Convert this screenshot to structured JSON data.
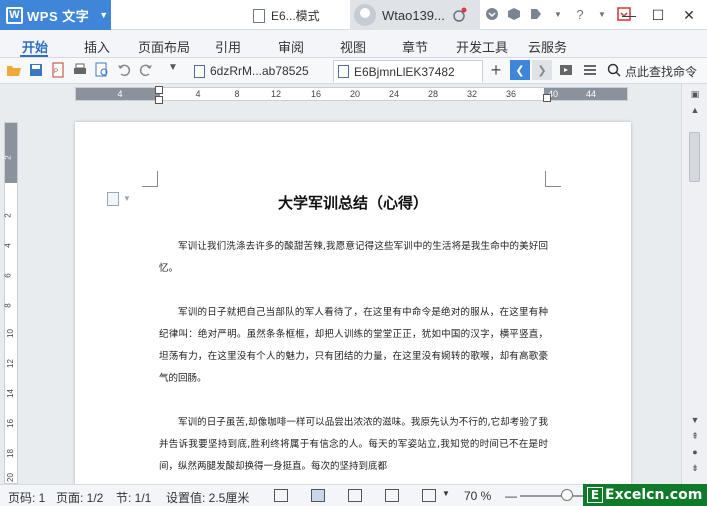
{
  "titlebar": {
    "app_name": "WPS 文字",
    "logo_letter": "W",
    "doc_title": "E6...模式",
    "user_name": "Wtao139...",
    "minimize": "—",
    "maximize": "☐",
    "close": "✕"
  },
  "menu": {
    "items": [
      "开始",
      "插入",
      "页面布局",
      "引用",
      "审阅",
      "视图",
      "章节",
      "开发工具",
      "云服务"
    ],
    "active": "开始"
  },
  "toolbar": {
    "tabs": [
      {
        "label": "6dzRrM...ab78525"
      },
      {
        "label": "E6BjmnLlEK37482"
      }
    ],
    "add_tab": "+",
    "search_label": "点此查找命令"
  },
  "ruler": {
    "corner": "L",
    "numbers": [
      "4",
      "4",
      "8",
      "12",
      "16",
      "20",
      "24",
      "28",
      "32",
      "36",
      "40",
      "44"
    ],
    "vertical_numbers": [
      "2",
      "2",
      "4",
      "6",
      "8",
      "10",
      "12",
      "14",
      "16",
      "18",
      "20"
    ]
  },
  "document": {
    "title": "大学军训总结（心得）",
    "paragraphs": [
      "军训让我们洗涤去许多的酸甜苦辣,我愿意记得这些军训中的生活将是我生命中的美好回忆。",
      "军训的日子就把自己当部队的军人看待了，在这里有中命令是绝对的服从，在这里有种纪律叫：绝对严明。虽然条条框框，却把人训练的堂堂正正，犹如中国的汉字，横平竖直，坦荡有力，在这里没有个人的魅力，只有团结的力量，在这里没有婉转的歌喉，却有高歌豪气的回肠。",
      "军训的日子虽苦,却像咖啡一样可以品尝出浓浓的滋味。我原先认为不行的,它却考验了我并告诉我要坚持到底,胜利终将属于有信念的人。每天的军姿站立,我知觉的时间已不在是时间，纵然两腿发酸却换得一身挺直。每次的坚持到底都"
    ]
  },
  "statusbar": {
    "page_code": "页码: 1",
    "pages": "页面: 1/2",
    "section": "节: 1/1",
    "setting": "设置值: 2.5厘米",
    "zoom": "70 %",
    "zoom_level": 0.5
  },
  "watermark": {
    "text": "Excelcn.com",
    "logo_letter": "E"
  },
  "colors": {
    "accent": "#3f86d8",
    "menu_active": "#2e6fc2",
    "watermark_bg": "#0f7a2a"
  }
}
